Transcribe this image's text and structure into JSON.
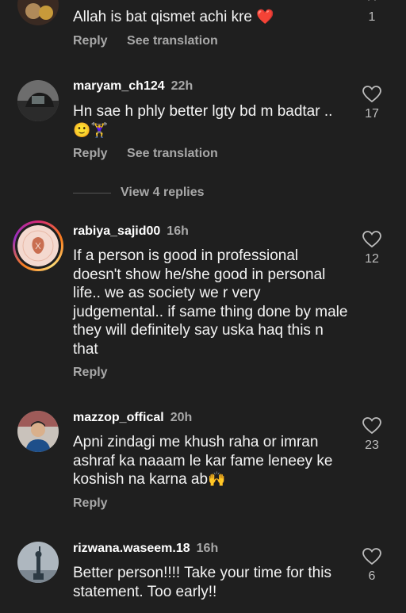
{
  "comments": [
    {
      "username": "",
      "time": "",
      "text": "Allah is bat qismet achi kre",
      "emoji": "❤️",
      "reply": "Reply",
      "see_translation": "See translation",
      "likes": "1"
    },
    {
      "username": "maryam_ch124",
      "time": "22h",
      "text": "Hn sae h phly better lgty bd m badtar ..",
      "emoji": "🙂🏋️‍♀️",
      "reply": "Reply",
      "see_translation": "See translation",
      "likes": "17",
      "view_replies": "View 4 replies"
    },
    {
      "username": "rabiya_sajid00",
      "time": "16h",
      "text": "If a person is good in professional doesn't show he/she good in personal life.. we as society we r very judgemental.. if same thing done by male they will definitely say uska haq this n that",
      "reply": "Reply",
      "likes": "12"
    },
    {
      "username": "mazzop_offical",
      "time": "20h",
      "text": "Apni zindagi me khush raha or imran ashraf ka naaam le kar fame leneey ke koshish na karna ab",
      "emoji": "🙌",
      "reply": "Reply",
      "likes": "23"
    },
    {
      "username": "rizwana.waseem.18",
      "time": "16h",
      "text": "Better person!!!! Take your time for this statement. Too early!!",
      "likes": "6"
    }
  ],
  "icons": {
    "like": "heart-outline-icon",
    "collapse": "chevron-up-icon"
  },
  "colors": {
    "background": "#1f1f1f",
    "secondary_text": "#a8a8a8",
    "heart_red": "#e0245e"
  }
}
